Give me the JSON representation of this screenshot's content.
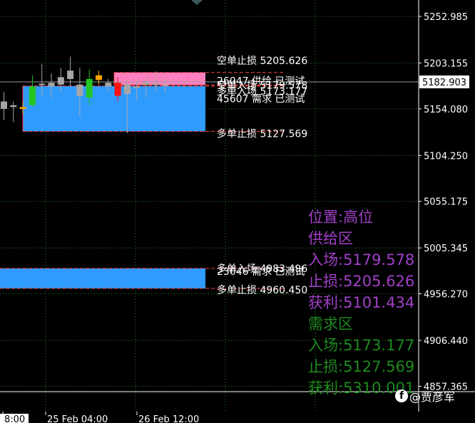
{
  "chart_data": {
    "type": "candlestick",
    "price_axis": {
      "ticks": [
        "5252.985",
        "5203.155",
        "5154.080",
        "5104.250",
        "5055.175",
        "5005.345",
        "4956.270",
        "4906.440",
        "4857.365"
      ],
      "tick_values": [
        5252.985,
        5203.155,
        5154.08,
        5104.25,
        5055.175,
        5005.345,
        4956.27,
        4906.44,
        4857.365
      ],
      "current_price": "5182.903",
      "current_price_value": 5182.903
    },
    "time_axis": {
      "labels": [
        "8:00",
        "25 Feb 04:00",
        "26 Feb 12:00"
      ]
    },
    "candles": [
      {
        "o": 5162,
        "h": 5172,
        "l": 5142,
        "c": 5154,
        "color": "gray"
      },
      {
        "o": 5156,
        "h": 5162,
        "l": 5140,
        "c": 5158,
        "color": "gray"
      },
      {
        "o": 5156,
        "h": 5162,
        "l": 5148,
        "c": 5154,
        "color": "orange"
      },
      {
        "o": 5158,
        "h": 5190,
        "l": 5156,
        "c": 5178,
        "color": "green"
      },
      {
        "o": 5180,
        "h": 5202,
        "l": 5168,
        "c": 5181,
        "color": "gray"
      },
      {
        "o": 5178,
        "h": 5192,
        "l": 5166,
        "c": 5182,
        "color": "gray"
      },
      {
        "o": 5180,
        "h": 5198,
        "l": 5172,
        "c": 5188,
        "color": "gray"
      },
      {
        "o": 5186,
        "h": 5210,
        "l": 5178,
        "c": 5195,
        "color": "gray"
      },
      {
        "o": 5180,
        "h": 5198,
        "l": 5146,
        "c": 5168,
        "color": "gray"
      },
      {
        "o": 5166,
        "h": 5196,
        "l": 5158,
        "c": 5186,
        "color": "green"
      },
      {
        "o": 5185,
        "h": 5195,
        "l": 5180,
        "c": 5190,
        "color": "orange"
      },
      {
        "o": 5182,
        "h": 5186,
        "l": 5172,
        "c": 5178,
        "color": "gray"
      },
      {
        "o": 5182,
        "h": 5188,
        "l": 5162,
        "c": 5168,
        "color": "red"
      },
      {
        "o": 5170,
        "h": 5184,
        "l": 5128,
        "c": 5180,
        "color": "gray"
      },
      {
        "o": 5178,
        "h": 5186,
        "l": 5163,
        "c": 5178,
        "color": "gray"
      },
      {
        "o": 5180,
        "h": 5188,
        "l": 5166,
        "c": 5182,
        "color": "gray"
      },
      {
        "o": 5181,
        "h": 5194,
        "l": 5172,
        "c": 5181,
        "color": "gray"
      },
      {
        "o": 5180,
        "h": 5186,
        "l": 5172,
        "c": 5180,
        "color": "gray"
      }
    ],
    "zones": [
      {
        "kind": "supply",
        "top": 5193.0,
        "bottom": 5179.578,
        "color": "#ff80c0"
      },
      {
        "kind": "demand",
        "top": 5178.5,
        "bottom": 5130.0,
        "color": "#2f9bff"
      },
      {
        "kind": "demand",
        "top": 4983.496,
        "bottom": 4962.0,
        "color": "#2f9bff"
      }
    ],
    "level_labels": [
      {
        "text": "空单止损 5205.626",
        "value": 5205.626
      },
      {
        "text": "26047 供给 已测试",
        "value": 5184.0
      },
      {
        "text": "空单入场 5179.578",
        "value": 5179.578
      },
      {
        "text": "多单入场 5173.177",
        "value": 5173.177
      },
      {
        "text": "45607 需求 已测试",
        "value": 5165.0
      },
      {
        "text": "多单止损 5127.569",
        "value": 5127.569
      },
      {
        "text": "多单入场 4983.496",
        "value": 4983.496
      },
      {
        "text": "23046 需求 已测试",
        "value": 4980.5
      },
      {
        "text": "多单止损 4960.450",
        "value": 4960.45
      }
    ],
    "info_panel": {
      "position": "位置:高位",
      "supply_title": "供给区",
      "supply_entry": "入场:5179.578",
      "supply_stop": "止损:5205.626",
      "supply_target": "获利:5101.434",
      "demand_title": "需求区",
      "demand_entry": "入场:5173.177",
      "demand_stop": "止损:5127.569",
      "demand_target": "获利:5310.001"
    },
    "colors": {
      "background": "#000000",
      "grid": "#2e8b2e",
      "supply": "#ff80c0",
      "demand": "#2f9bff",
      "up": "#22c522",
      "down": "#ff1010",
      "neutral": "#a6a6a6",
      "marker": "#ffa500",
      "info_supply": "#a040c8",
      "info_demand": "#1f8a1f"
    }
  },
  "watermark": {
    "icon": "facebook-icon",
    "handle": "@贾彦军"
  }
}
